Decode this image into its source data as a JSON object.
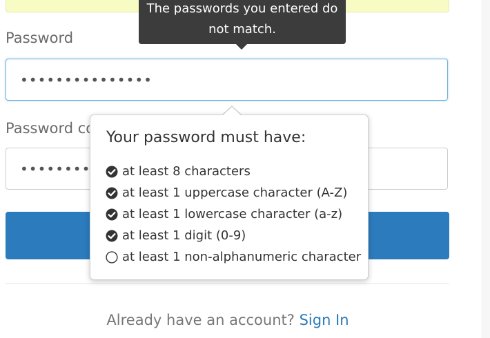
{
  "form": {
    "password_label": "Password",
    "password_value": "•••••••••••••••",
    "confirm_label": "Password co",
    "confirm_value": "•••••••••••",
    "submit_label": ""
  },
  "tooltip": {
    "line1": "The passwords you entered do",
    "line2": "not match."
  },
  "popover": {
    "title": "Your password must have:",
    "requirements": [
      {
        "text": "at least 8 characters",
        "met": true,
        "icon": "check-circle-icon"
      },
      {
        "text": "at least 1 uppercase character (A-Z)",
        "met": true,
        "icon": "check-circle-icon"
      },
      {
        "text": "at least 1 lowercase character (a-z)",
        "met": true,
        "icon": "check-circle-icon"
      },
      {
        "text": "at least 1 digit (0-9)",
        "met": true,
        "icon": "check-circle-icon"
      },
      {
        "text": "at least 1 non-alphanumeric character",
        "met": false,
        "icon": "empty-circle-icon"
      }
    ]
  },
  "footer": {
    "prompt": "Already have an account?",
    "link": "Sign In"
  },
  "colors": {
    "accent": "#2b7bbd",
    "tooltip_bg": "#3c3c3c",
    "notice_bg": "#f8fcc4",
    "link": "#2a7ab8"
  }
}
